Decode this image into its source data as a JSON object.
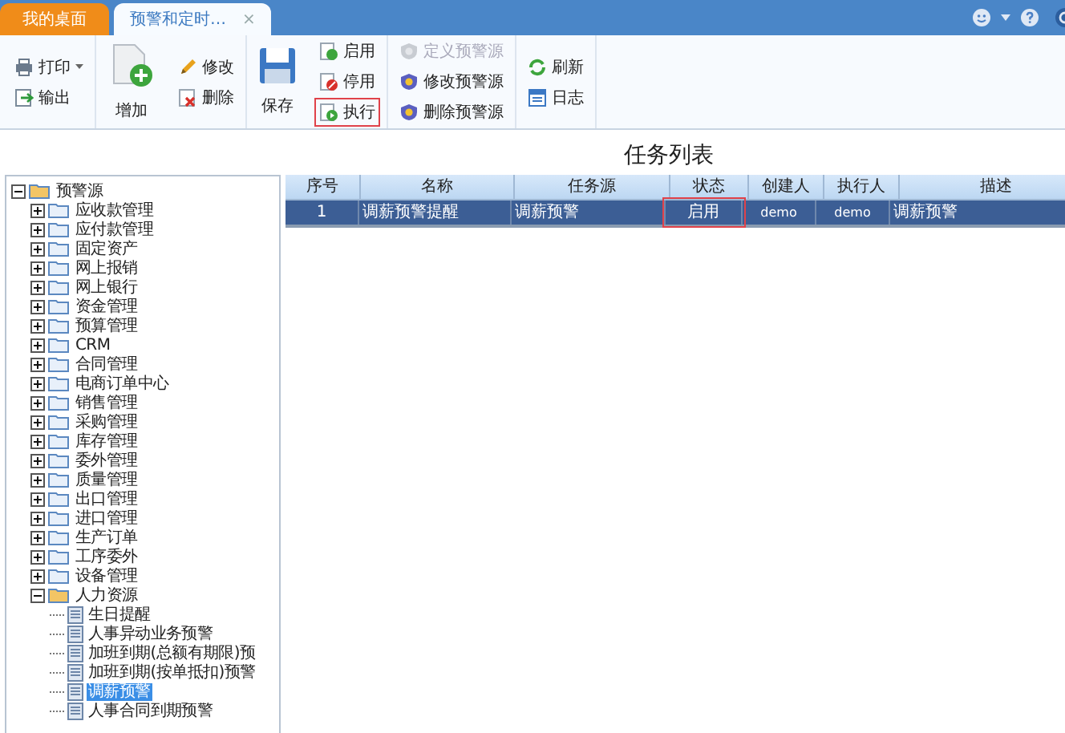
{
  "tabs": [
    {
      "label": "我的桌面",
      "selected": false
    },
    {
      "label": "预警和定时…",
      "selected": true,
      "close": "×"
    }
  ],
  "toolbar": {
    "groups": [
      [
        {
          "label": "打印",
          "kind": "small",
          "dropdown": true,
          "disabled": false,
          "highlighted": false
        },
        {
          "label": "输出",
          "kind": "small",
          "dropdown": false,
          "disabled": false,
          "highlighted": false
        }
      ],
      [
        {
          "label": "增加",
          "kind": "large",
          "dropdown": false,
          "disabled": false,
          "highlighted": false
        }
      ],
      [
        {
          "label": "修改",
          "kind": "small",
          "dropdown": false,
          "disabled": false,
          "highlighted": false
        },
        {
          "label": "删除",
          "kind": "small",
          "dropdown": false,
          "disabled": false,
          "highlighted": false
        }
      ],
      [
        {
          "label": "保存",
          "kind": "large",
          "dropdown": false,
          "disabled": false,
          "highlighted": false
        }
      ],
      [
        {
          "label": "启用",
          "kind": "small",
          "dropdown": false,
          "disabled": false,
          "highlighted": false
        },
        {
          "label": "停用",
          "kind": "small",
          "dropdown": false,
          "disabled": false,
          "highlighted": false
        },
        {
          "label": "执行",
          "kind": "small",
          "dropdown": false,
          "disabled": false,
          "highlighted": true
        }
      ],
      [
        {
          "label": "定义预警源",
          "kind": "small",
          "dropdown": false,
          "disabled": true,
          "highlighted": false
        },
        {
          "label": "修改预警源",
          "kind": "small",
          "dropdown": false,
          "disabled": false,
          "highlighted": false
        },
        {
          "label": "删除预警源",
          "kind": "small",
          "dropdown": false,
          "disabled": false,
          "highlighted": false
        }
      ],
      [
        {
          "label": "刷新",
          "kind": "small",
          "dropdown": false,
          "disabled": false,
          "highlighted": false
        },
        {
          "label": "日志",
          "kind": "small",
          "dropdown": false,
          "disabled": false,
          "highlighted": false
        }
      ]
    ]
  },
  "title": "任务列表",
  "tree": [
    {
      "label": "预警源",
      "kind": "folder",
      "expanded": true,
      "selected": false,
      "children": [
        {
          "label": "应收款管理",
          "kind": "folder",
          "expanded": false,
          "selected": false
        },
        {
          "label": "应付款管理",
          "kind": "folder",
          "expanded": false,
          "selected": false
        },
        {
          "label": "固定资产",
          "kind": "folder",
          "expanded": false,
          "selected": false
        },
        {
          "label": "网上报销",
          "kind": "folder",
          "expanded": false,
          "selected": false
        },
        {
          "label": "网上银行",
          "kind": "folder",
          "expanded": false,
          "selected": false
        },
        {
          "label": "资金管理",
          "kind": "folder",
          "expanded": false,
          "selected": false
        },
        {
          "label": "预算管理",
          "kind": "folder",
          "expanded": false,
          "selected": false
        },
        {
          "label": "CRM",
          "kind": "folder",
          "expanded": false,
          "selected": false
        },
        {
          "label": "合同管理",
          "kind": "folder",
          "expanded": false,
          "selected": false
        },
        {
          "label": "电商订单中心",
          "kind": "folder",
          "expanded": false,
          "selected": false
        },
        {
          "label": "销售管理",
          "kind": "folder",
          "expanded": false,
          "selected": false
        },
        {
          "label": "采购管理",
          "kind": "folder",
          "expanded": false,
          "selected": false
        },
        {
          "label": "库存管理",
          "kind": "folder",
          "expanded": false,
          "selected": false
        },
        {
          "label": "委外管理",
          "kind": "folder",
          "expanded": false,
          "selected": false
        },
        {
          "label": "质量管理",
          "kind": "folder",
          "expanded": false,
          "selected": false
        },
        {
          "label": "出口管理",
          "kind": "folder",
          "expanded": false,
          "selected": false
        },
        {
          "label": "进口管理",
          "kind": "folder",
          "expanded": false,
          "selected": false
        },
        {
          "label": "生产订单",
          "kind": "folder",
          "expanded": false,
          "selected": false
        },
        {
          "label": "工序委外",
          "kind": "folder",
          "expanded": false,
          "selected": false
        },
        {
          "label": "设备管理",
          "kind": "folder",
          "expanded": false,
          "selected": false
        },
        {
          "label": "人力资源",
          "kind": "folder",
          "expanded": true,
          "selected": false,
          "children": [
            {
              "label": "生日提醒",
              "kind": "leaf",
              "selected": false
            },
            {
              "label": "人事异动业务预警",
              "kind": "leaf",
              "selected": false
            },
            {
              "label": "加班到期(总额有期限)预",
              "kind": "leaf",
              "selected": false
            },
            {
              "label": "加班到期(按单抵扣)预警",
              "kind": "leaf",
              "selected": false
            },
            {
              "label": "调薪预警",
              "kind": "leaf",
              "selected": true
            },
            {
              "label": "人事合同到期预警",
              "kind": "leaf",
              "selected": false
            }
          ]
        }
      ]
    }
  ],
  "table": {
    "columns": [
      "序号",
      "名称",
      "任务源",
      "状态",
      "创建人",
      "执行人",
      "描述"
    ],
    "rows": [
      {
        "selected": true,
        "cells": [
          {
            "text": "1",
            "highlighted": false
          },
          {
            "text": "调薪预警提醒",
            "highlighted": false
          },
          {
            "text": "调薪预警",
            "highlighted": false
          },
          {
            "text": "启用",
            "highlighted": true
          },
          {
            "text": "demo",
            "highlighted": false
          },
          {
            "text": "demo",
            "highlighted": false
          },
          {
            "text": "调薪预警",
            "highlighted": false
          }
        ]
      }
    ]
  }
}
